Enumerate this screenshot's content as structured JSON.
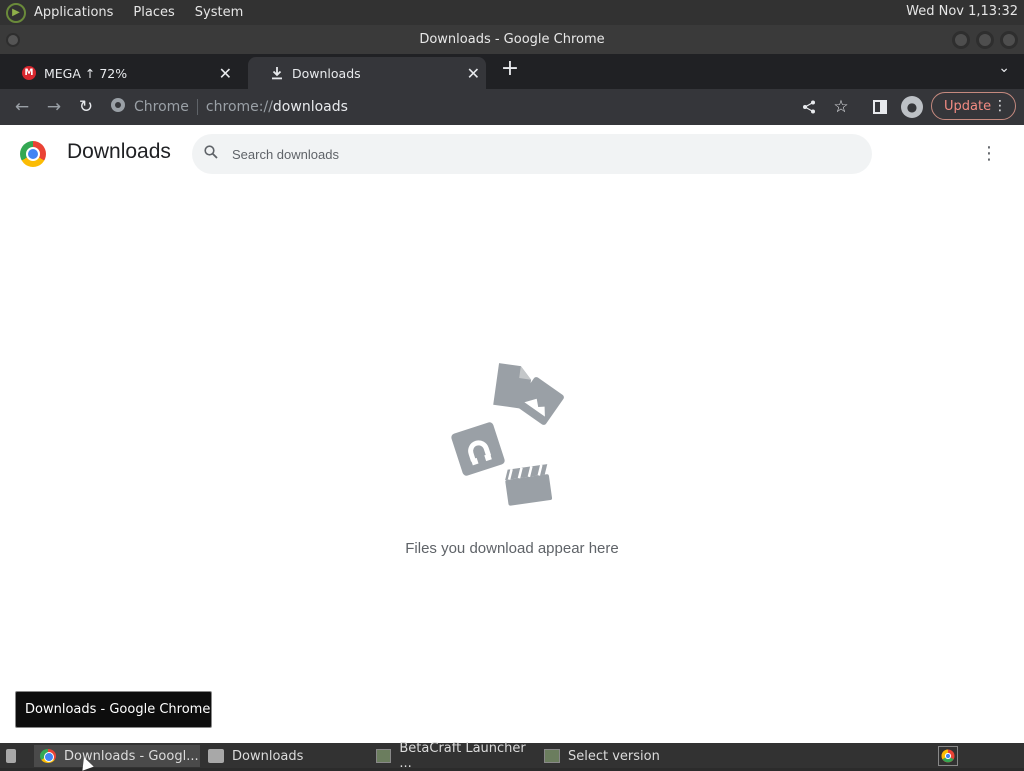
{
  "desktop": {
    "menus": [
      "Applications",
      "Places",
      "System"
    ],
    "clock": "Wed Nov 1,13:32"
  },
  "window": {
    "title": "Downloads - Google Chrome"
  },
  "tabs": [
    {
      "label": "MEGA ↑ 72%",
      "favicon": "M"
    },
    {
      "label": "Downloads"
    }
  ],
  "toolbar": {
    "site_label": "Chrome",
    "url_scheme": "chrome://",
    "url_path": "downloads",
    "update_label": "Update"
  },
  "page": {
    "title": "Downloads",
    "search_placeholder": "Search downloads",
    "empty_message": "Files you download appear here"
  },
  "tooltip": "Downloads - Google Chrome",
  "taskbar": {
    "items": [
      "Downloads - Googl...",
      "Downloads",
      "BetaCraft Launcher ...",
      "Select version"
    ]
  },
  "colors": {
    "chrome_dark": "#202124",
    "toolbar_dark": "#35363a",
    "update_red": "#f28b82",
    "empty_icon_gray": "#9aa0a6"
  }
}
